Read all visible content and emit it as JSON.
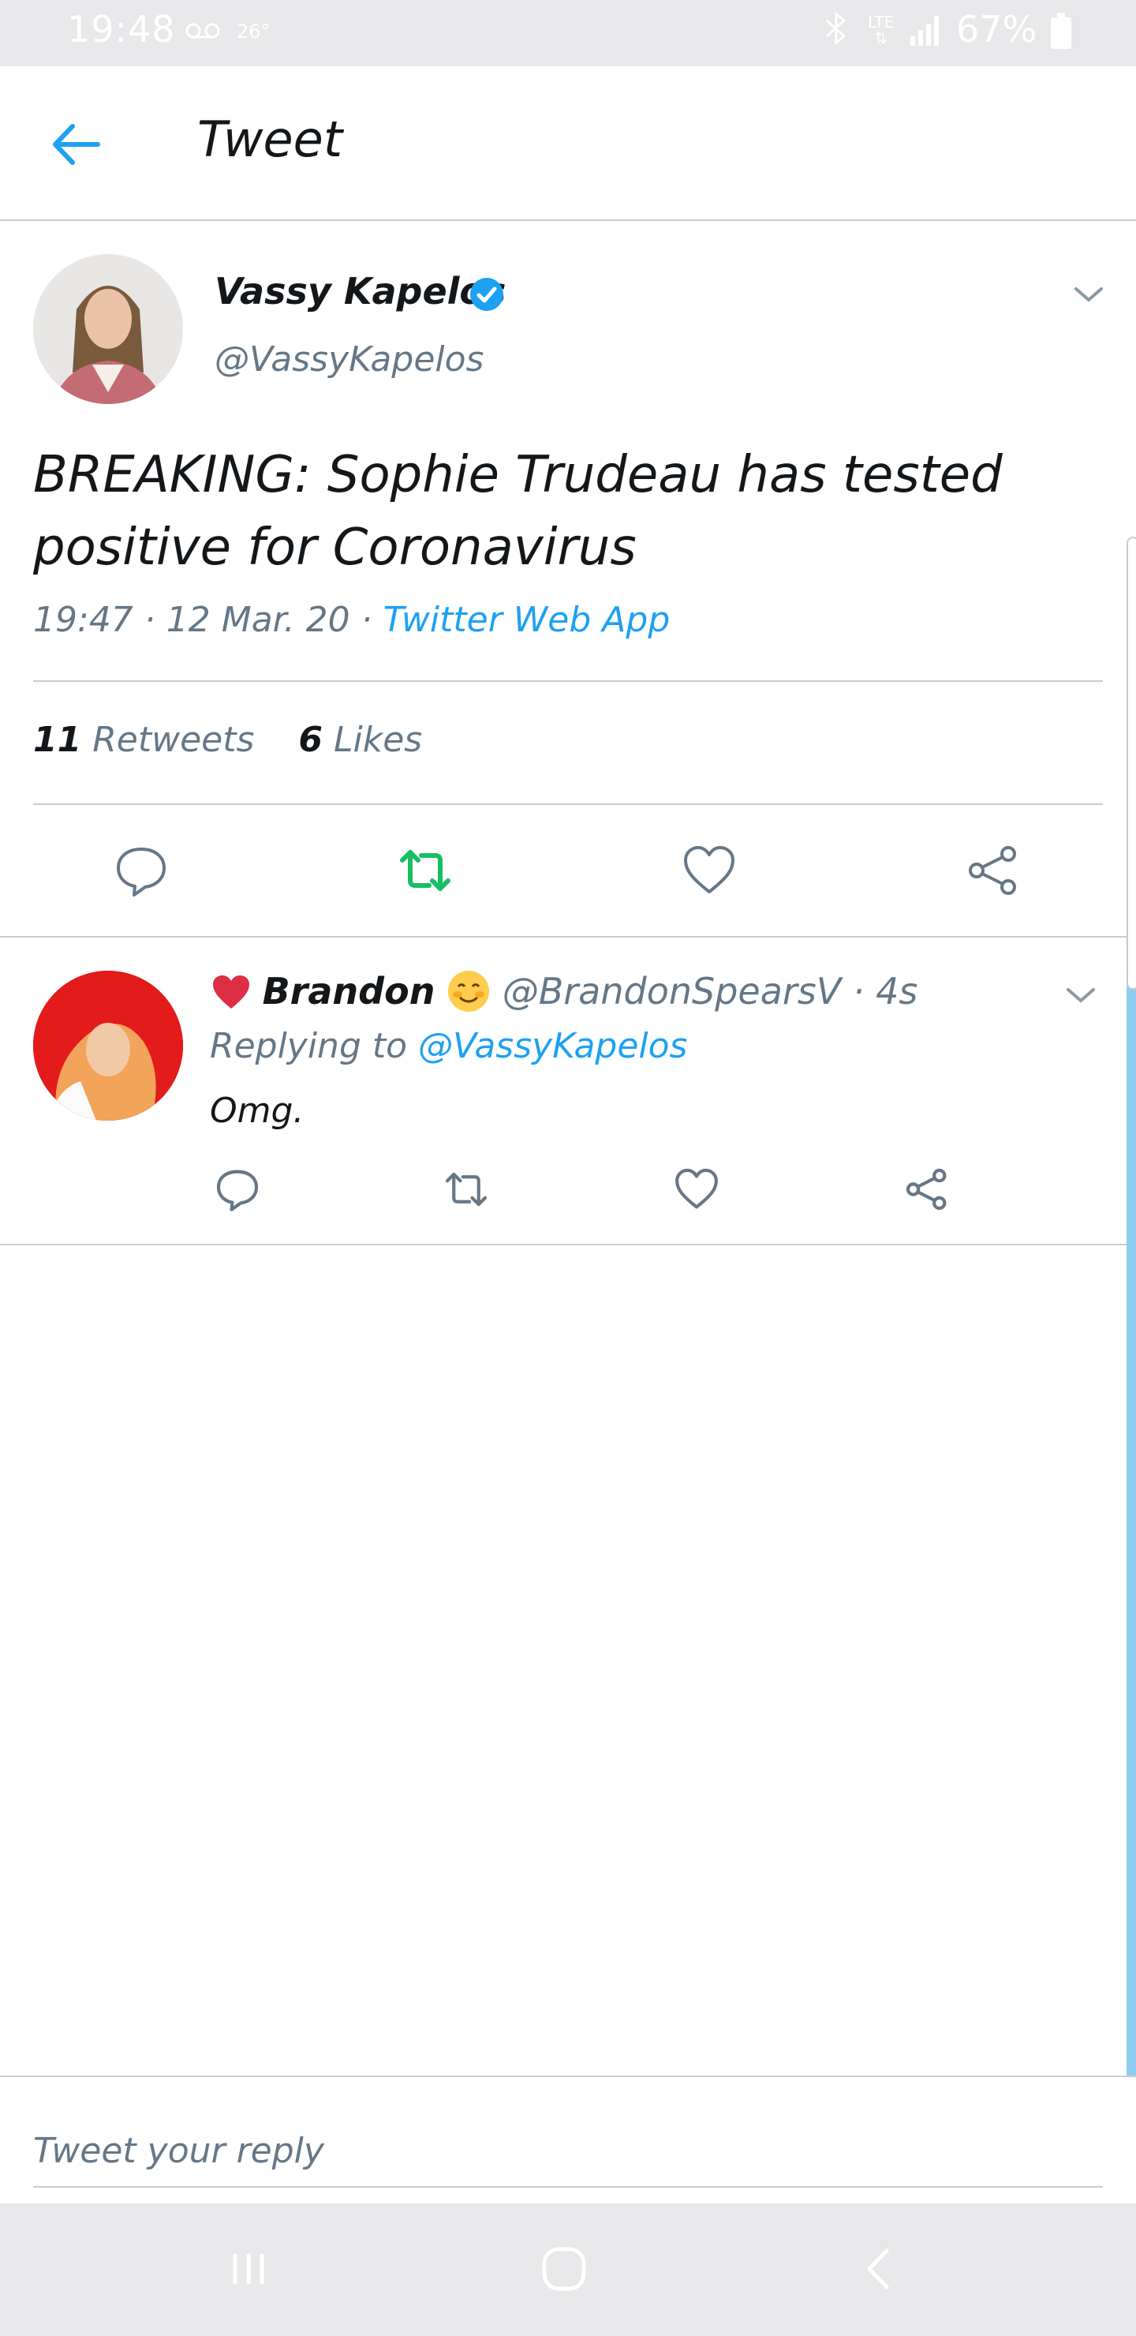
{
  "status_bar": {
    "time": "19:48",
    "voicemail_icon": "voicemail-icon",
    "temperature": "26°",
    "bluetooth_icon": "bluetooth-icon",
    "network": "LTE",
    "battery_percent": "67%"
  },
  "header": {
    "back_icon": "arrow-left-icon",
    "title": "Tweet"
  },
  "tweet": {
    "author_name": "Vassy Kapelos",
    "verified": true,
    "handle": "@VassyKapelos",
    "text": "BREAKING: Sophie Trudeau has tested positive for Coronavirus",
    "timestamp": "19:47 · 12 Mar. 20 · ",
    "source": "Twitter Web App",
    "retweet_count": "11",
    "retweet_label": "Retweets",
    "like_count": "6",
    "like_label": "Likes",
    "accent_color": "#1da1f2",
    "retweet_active_color": "#17bf63"
  },
  "reply": {
    "name": "Brandon",
    "handle_time": "@BrandonSpearsV · 4s",
    "replying_prefix": "Replying to ",
    "replying_to": "@VassyKapelos",
    "text": "Omg."
  },
  "compose": {
    "placeholder": "Tweet your reply"
  }
}
